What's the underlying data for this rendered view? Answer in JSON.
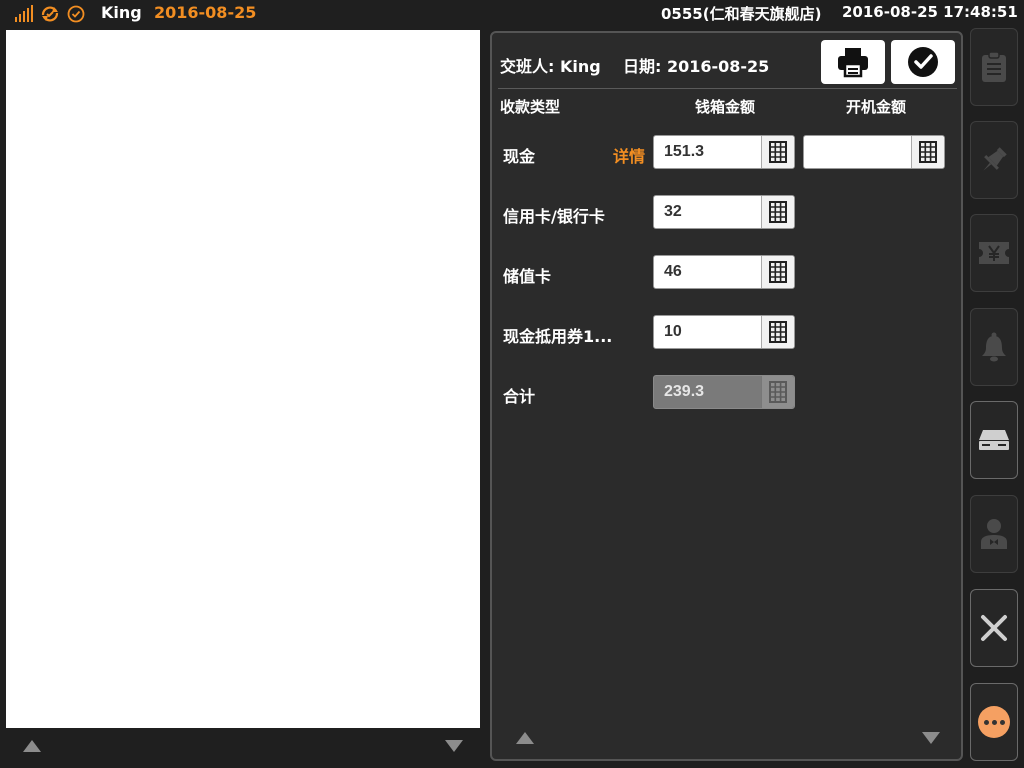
{
  "topbar": {
    "user": "King",
    "date": "2016-08-25",
    "store": "0555(仁和春天旗舰店)",
    "clock": "2016-08-25 17:48:51",
    "icons": [
      "signal-icon",
      "sync-icon",
      "check-circle-icon"
    ]
  },
  "header": {
    "handover_label": "交班人: King",
    "date_label": "日期: 2016-08-25",
    "print_icon": "printer-icon",
    "confirm_icon": "checkmark-icon"
  },
  "columns": {
    "type": "收款类型",
    "drawer": "钱箱金额",
    "opening": "开机金额"
  },
  "rows": [
    {
      "label": "现金",
      "drawer": "151.3",
      "opening": "",
      "detail": "详情"
    },
    {
      "label": "信用卡/银行卡",
      "drawer": "32"
    },
    {
      "label": "储值卡",
      "drawer": "46"
    },
    {
      "label": "现金抵用券1...",
      "drawer": "10"
    }
  ],
  "total": {
    "label": "合计",
    "value": "239.3"
  },
  "sidebar": [
    "clipboard-icon",
    "pin-icon",
    "ticket-yen-icon",
    "bell-icon",
    "drawer-icon",
    "cashier-icon",
    "close-icon",
    "more-icon"
  ],
  "colors": {
    "accent": "#f28e22",
    "background": "#1f1f1f",
    "panel": "#2b2b2b"
  }
}
